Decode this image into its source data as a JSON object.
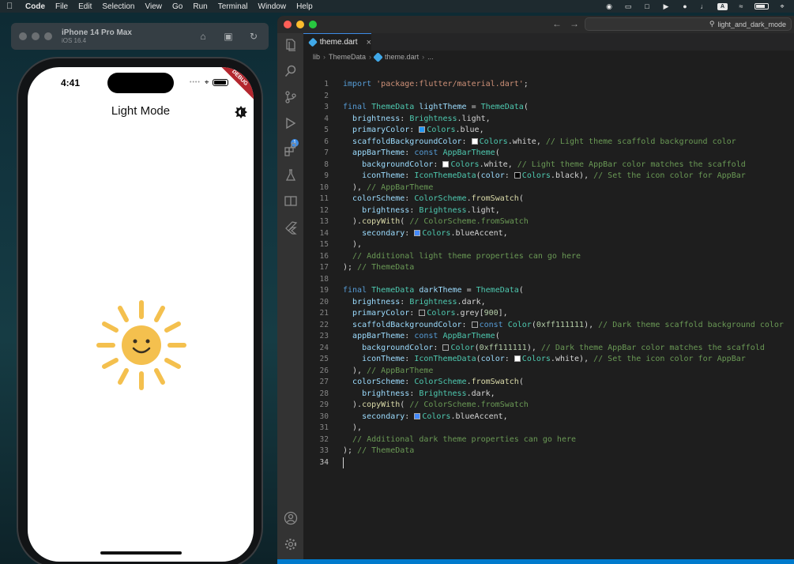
{
  "menubar": {
    "app": "Code",
    "items": [
      "File",
      "Edit",
      "Selection",
      "View",
      "Go",
      "Run",
      "Terminal",
      "Window",
      "Help"
    ],
    "input_source": "A"
  },
  "simulator": {
    "device": "iPhone 14 Pro Max",
    "os": "iOS 16.4"
  },
  "phone": {
    "time": "4:41",
    "debug_label": "DEBUG",
    "app_title": "Light Mode"
  },
  "vscode": {
    "search": "light_and_dark_mode",
    "tab": "theme.dart",
    "breadcrumb": [
      "lib",
      "ThemeData",
      "theme.dart",
      "..."
    ],
    "badge_count": "1",
    "total_lines": 34,
    "active_line": 34,
    "code_lines": [
      "import 'package:flutter/material.dart';",
      "",
      "final ThemeData lightTheme = ThemeData(",
      "  brightness: Brightness.light,",
      "  primaryColor: Colors.blue,",
      "  scaffoldBackgroundColor: Colors.white, // Light theme scaffold background color",
      "  appBarTheme: const AppBarTheme(",
      "    backgroundColor: Colors.white, // Light theme AppBar color matches the scaffold",
      "    iconTheme: IconThemeData(color: Colors.black), // Set the icon color for AppBar",
      "  ), // AppBarTheme",
      "  colorScheme: ColorScheme.fromSwatch(",
      "    brightness: Brightness.light,",
      "  ).copyWith( // ColorScheme.fromSwatch",
      "    secondary: Colors.blueAccent,",
      "  ),",
      "  // Additional light theme properties can go here",
      "); // ThemeData",
      "",
      "final ThemeData darkTheme = ThemeData(",
      "  brightness: Brightness.dark,",
      "  primaryColor: Colors.grey[900],",
      "  scaffoldBackgroundColor: const Color(0xff111111), // Dark theme scaffold background color",
      "  appBarTheme: const AppBarTheme(",
      "    backgroundColor: Color(0xff111111), // Dark theme AppBar color matches the scaffold",
      "    iconTheme: IconThemeData(color: Colors.white), // Set the icon color for AppBar",
      "  ), // AppBarTheme",
      "  colorScheme: ColorScheme.fromSwatch(",
      "    brightness: Brightness.dark,",
      "  ).copyWith( // ColorScheme.fromSwatch",
      "    secondary: Colors.blueAccent,",
      "  ),",
      "  // Additional dark theme properties can go here",
      "); // ThemeData",
      ""
    ]
  },
  "colors": {
    "accent": "#007acc",
    "sun": "#f4c04e",
    "keyword": "#569cd6",
    "string": "#ce9178",
    "type": "#4ec9b0",
    "property": "#9cdcfe",
    "comment": "#6a9955"
  }
}
